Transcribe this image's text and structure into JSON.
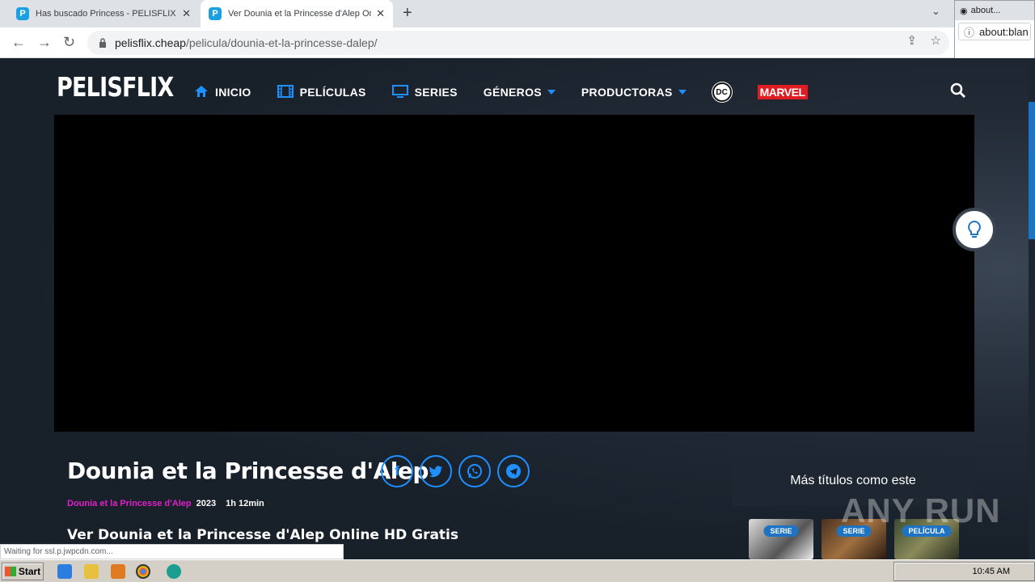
{
  "browser": {
    "tabs": [
      {
        "title": "Has buscado Princess - PELISFLIX [",
        "favicon": "P"
      },
      {
        "title": "Ver Dounia et la Princesse d'Alep Onl",
        "favicon": "P"
      }
    ],
    "url_host": "pelisflix.cheap",
    "url_path": "/pelicula/dounia-et-la-princesse-dalep/",
    "popup_tab": "about...",
    "popup_url": "about:blan",
    "status_text": "Waiting for ssl.p.jwpcdn.com..."
  },
  "site": {
    "logo": "PELISFLIX",
    "nav": {
      "inicio": "INICIO",
      "peliculas": "PELÍCULAS",
      "series": "SERIES",
      "generos": "GÉNEROS",
      "productoras": "PRODUCTORAS",
      "dc": "DC",
      "marvel": "MARVEL"
    }
  },
  "movie": {
    "title": "Dounia et la Princesse d'Alep",
    "original_title": "Dounia et la Princesse d'Alep",
    "year": "2023",
    "duration": "1h 12min",
    "subheading": "Ver Dounia et la Princesse d'Alep Online HD Gratis"
  },
  "sidebar": {
    "heading": "Más títulos como este",
    "cards": [
      {
        "badge": "SERIE"
      },
      {
        "badge": "SERIE"
      },
      {
        "badge": "PELÍCULA"
      }
    ]
  },
  "watermark": "ANY RUN",
  "taskbar": {
    "start": "Start",
    "clock": "10:45 AM"
  },
  "colors": {
    "accent": "#1e90ff",
    "magenta": "#e020c8",
    "background": "#1a222c"
  }
}
